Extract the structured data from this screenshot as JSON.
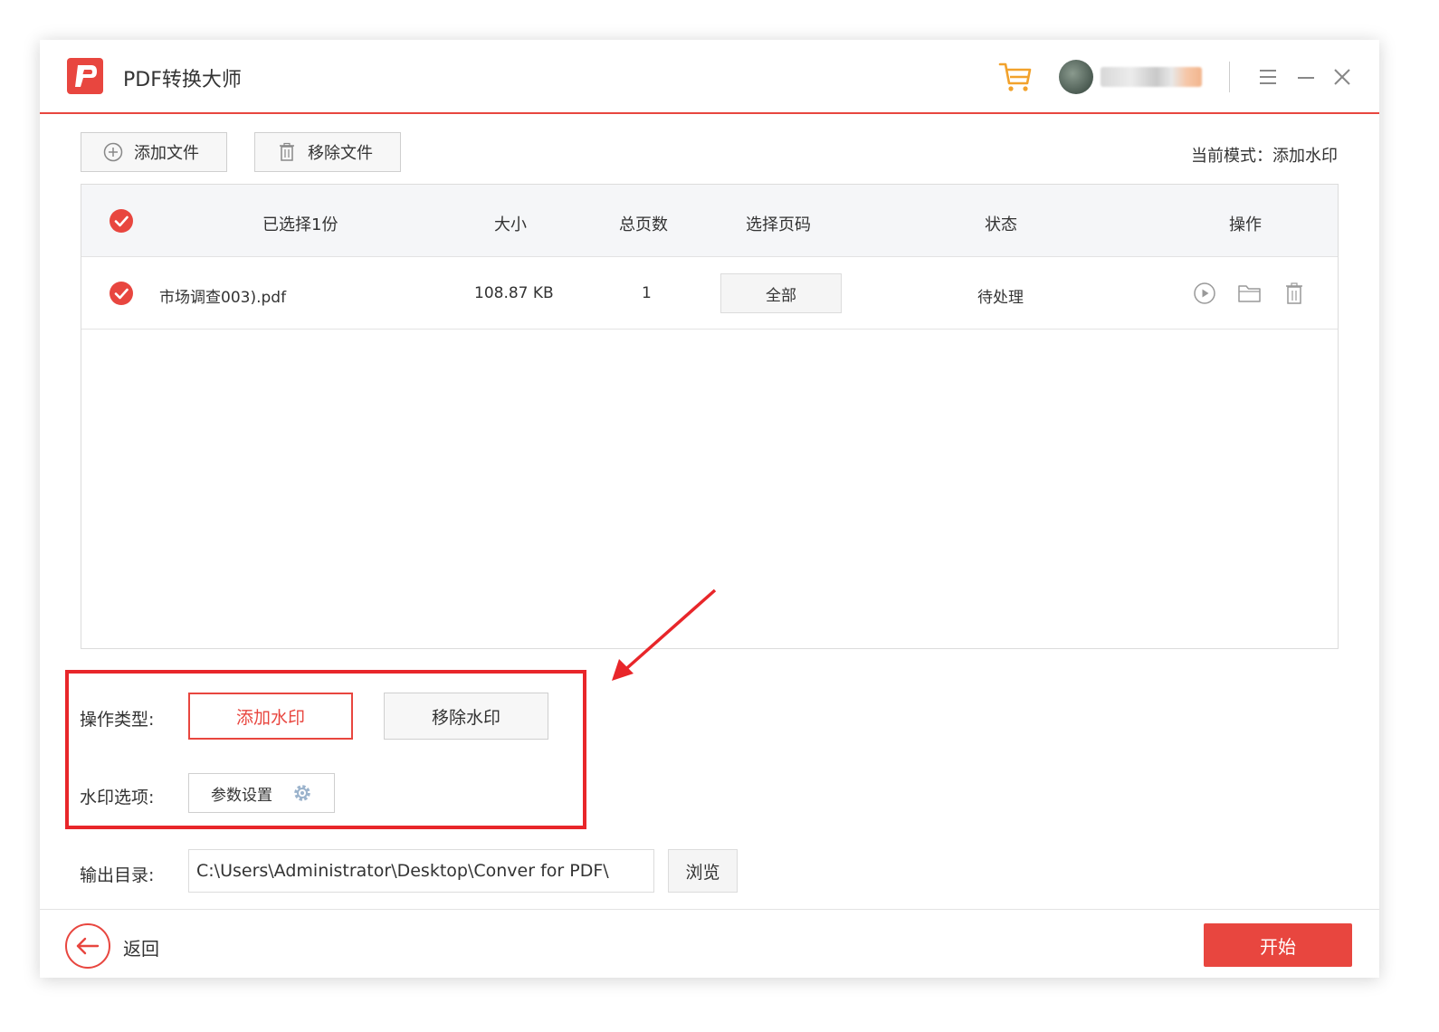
{
  "app": {
    "title": "PDF转换大师",
    "brand_color": "#e8463f",
    "logo_letter": "P"
  },
  "toolbar": {
    "add_file_label": "添加文件",
    "remove_file_label": "移除文件",
    "mode_text": "当前模式：添加水印"
  },
  "table": {
    "headers": {
      "selected": "已选择1份",
      "size": "大小",
      "pages": "总页数",
      "page_select": "选择页码",
      "status": "状态",
      "actions": "操作"
    },
    "rows": [
      {
        "filename": "市场调查003).pdf",
        "size": "108.87 KB",
        "pages": "1",
        "page_select": "全部",
        "status": "待处理",
        "actions": [
          "play-icon",
          "folder-icon",
          "trash-icon"
        ]
      }
    ]
  },
  "options": {
    "operation_type_label": "操作类型:",
    "add_watermark_label": "添加水印",
    "remove_watermark_label": "移除水印",
    "watermark_options_label": "水印选项:",
    "param_settings_label": "参数设置"
  },
  "output": {
    "label": "输出目录:",
    "path": "C:\\Users\\Administrator\\Desktop\\Conver for PDF\\",
    "browse_label": "浏览"
  },
  "footer": {
    "back_label": "返回",
    "start_label": "开始"
  },
  "annotation": {
    "highlight_color": "#e8262a"
  }
}
